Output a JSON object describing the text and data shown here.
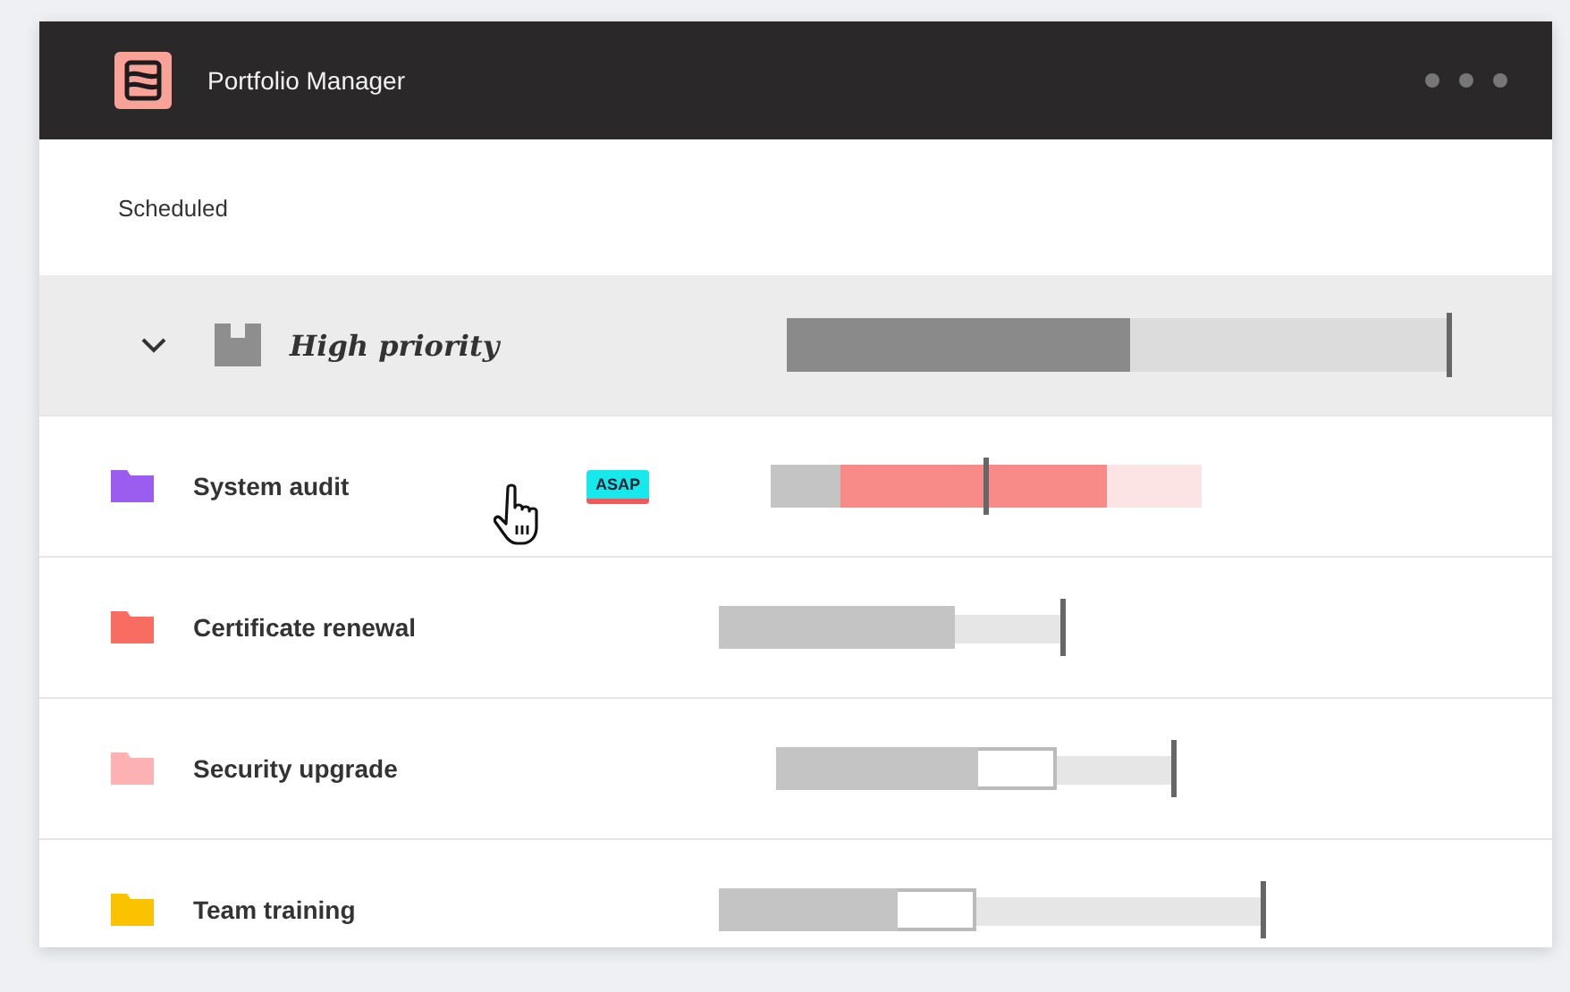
{
  "window": {
    "title": "Portfolio Manager"
  },
  "section": "Scheduled",
  "group": {
    "label": "High priority",
    "expanded": true,
    "level": 0.52
  },
  "rows": [
    {
      "name": "System audit",
      "color": "#9b5cf0",
      "badge": "ASAP",
      "level": 0.16
    },
    {
      "name": "Certificate renewal",
      "color": "#f86c62",
      "level": 0.69
    },
    {
      "name": "Security upgrade",
      "color": "#fdb1b3",
      "level": 0.51
    },
    {
      "name": "Team training",
      "color": "#fbc200",
      "level": 0.33
    }
  ]
}
